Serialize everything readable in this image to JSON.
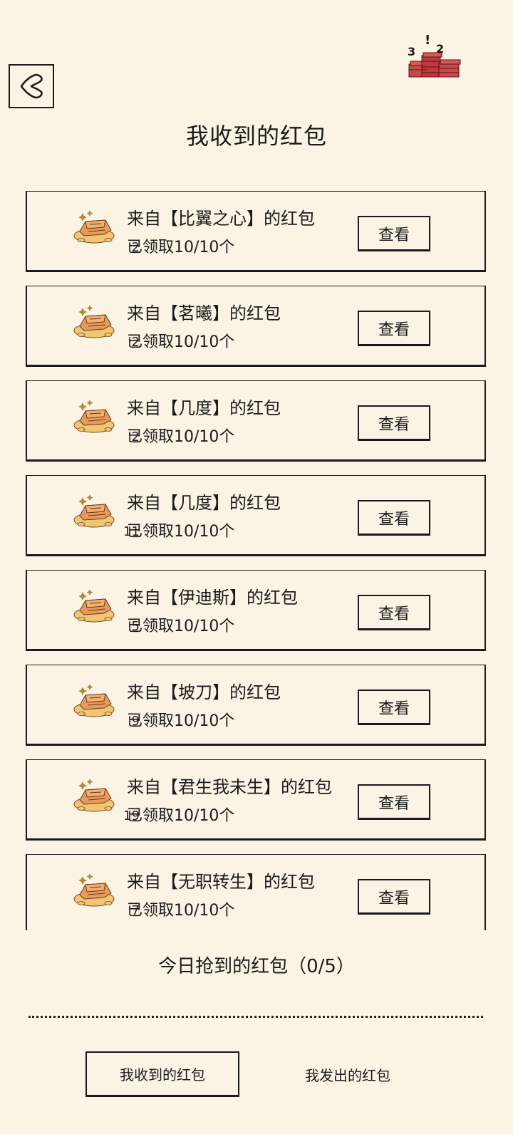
{
  "header": {
    "title": "我收到的红包",
    "deco_numbers": [
      "3",
      "!",
      "2"
    ]
  },
  "cards": [
    {
      "title": "来自【比翼之心】的红包",
      "sub": "已领取10/10个",
      "count": "2",
      "button": "查看"
    },
    {
      "title": "来自【茗曦】的红包",
      "sub": "已领取10/10个",
      "count": "2",
      "button": "查看"
    },
    {
      "title": "来自【几度】的红包",
      "sub": "已领取10/10个",
      "count": "2",
      "button": "查看"
    },
    {
      "title": "来自【几度】的红包",
      "sub": "已领取10/10个",
      "count": "11",
      "button": "查看"
    },
    {
      "title": "来自【伊迪斯】的红包",
      "sub": "已领取10/10个",
      "count": "5",
      "button": "查看"
    },
    {
      "title": "来自【坡刀】的红包",
      "sub": "已领取10/10个",
      "count": "9",
      "button": "查看"
    },
    {
      "title": "来自【君生我未生】的红包",
      "sub": "已领取10/10个",
      "count": "19",
      "button": "查看"
    },
    {
      "title": "来自【无职转生】的红包",
      "sub": "已领取10/10个",
      "count": "7",
      "button": "查看"
    }
  ],
  "footer": {
    "today": "今日抢到的红包（0/5）",
    "tab_received": "我收到的红包",
    "tab_sent": "我发出的红包"
  }
}
